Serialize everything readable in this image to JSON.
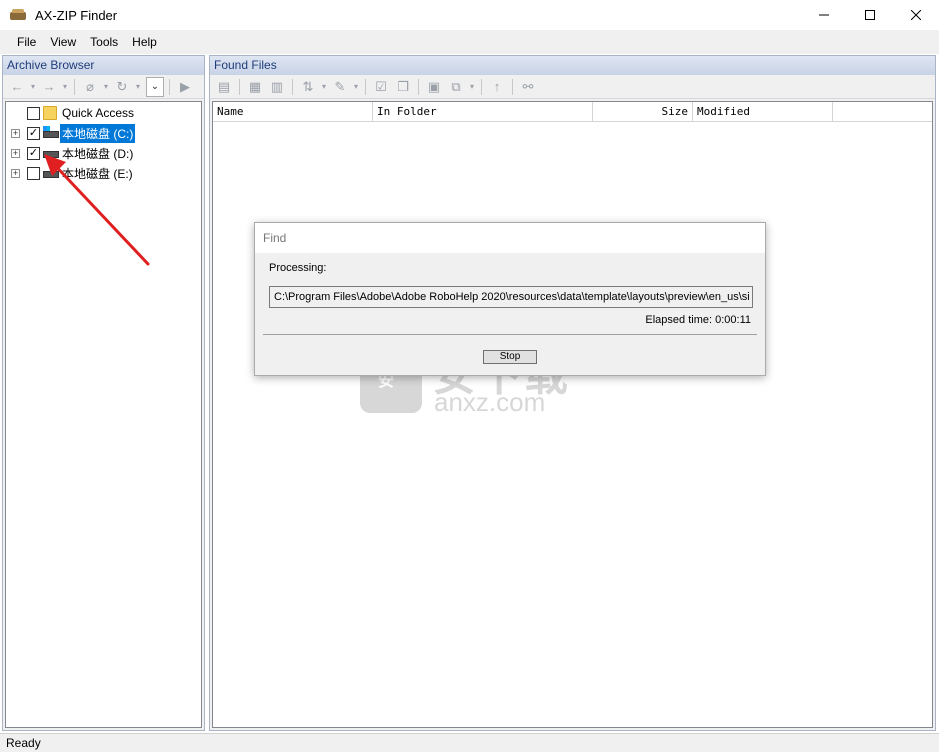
{
  "window": {
    "title": "AX-ZIP Finder",
    "icon": "app-box-icon",
    "controls": [
      "minimize-icon",
      "maximize-icon",
      "close-icon"
    ]
  },
  "menu": {
    "items": [
      "File",
      "View",
      "Tools",
      "Help"
    ]
  },
  "archive_browser": {
    "title": "Archive Browser",
    "tree": [
      {
        "label": "Quick Access",
        "checked": false,
        "expandable": false,
        "selected": false,
        "icon": "folder-icon"
      },
      {
        "label": "本地磁盘 (C:)",
        "checked": true,
        "expandable": true,
        "selected": true,
        "icon": "system-drive-icon"
      },
      {
        "label": "本地磁盘 (D:)",
        "checked": true,
        "expandable": true,
        "selected": false,
        "icon": "drive-icon"
      },
      {
        "label": "本地磁盘 (E:)",
        "checked": false,
        "expandable": true,
        "selected": false,
        "icon": "drive-icon"
      }
    ]
  },
  "found_files": {
    "title": "Found Files",
    "columns": [
      "Name",
      "In Folder",
      "Size",
      "Modified"
    ]
  },
  "find_dialog": {
    "title": "Find",
    "processing_label": "Processing:",
    "path": "C:\\Program Files\\Adobe\\Adobe RoboHelp 2020\\resources\\data\\template\\layouts\\preview\\en_us\\si",
    "elapsed": "Elapsed time: 0:00:11",
    "stop_label": "Stop"
  },
  "watermark": {
    "cn": "安下载",
    "en": "anxz.com"
  },
  "status": {
    "text": "Ready"
  },
  "colors": {
    "selection": "#0078d7",
    "pane_header_text": "#1f3d7a",
    "arrow": "#e02020"
  }
}
